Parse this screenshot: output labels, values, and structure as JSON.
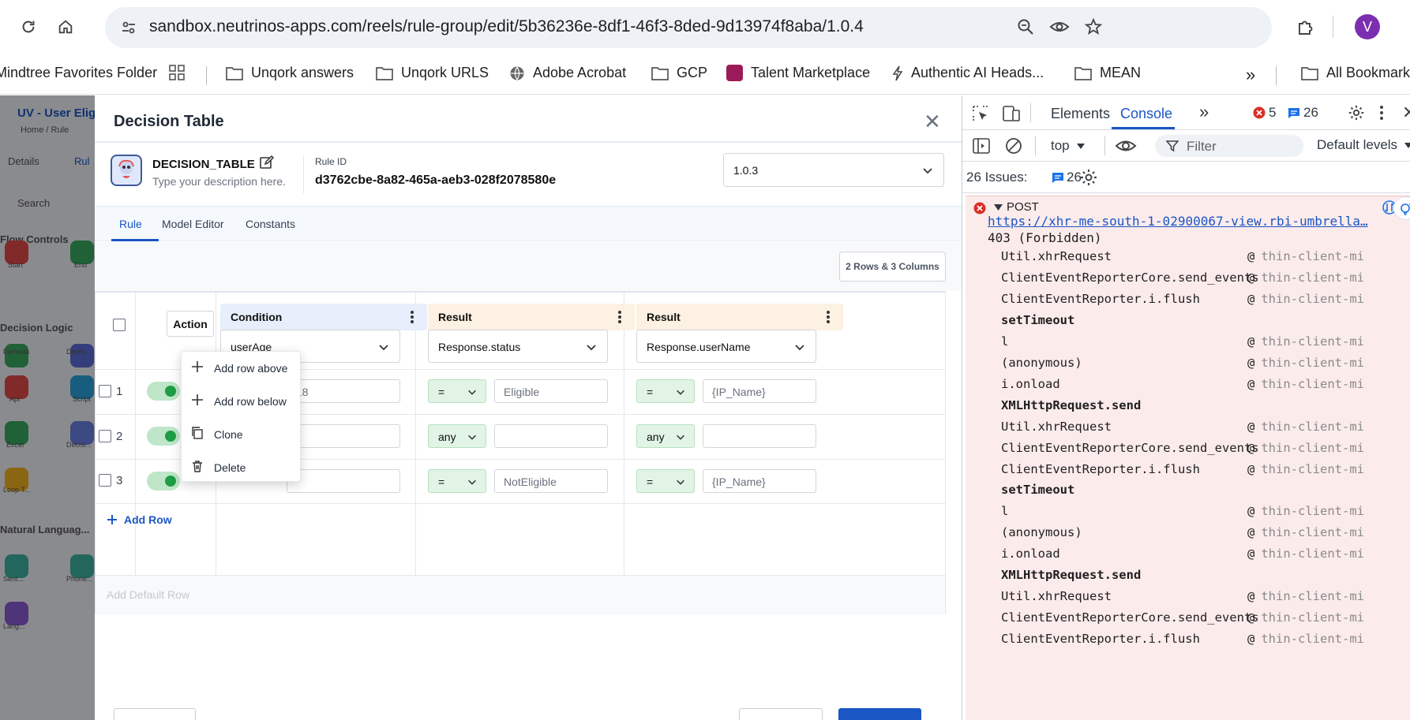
{
  "browser": {
    "url": "sandbox.neutrinos-apps.com/reels/rule-group/edit/5b36236e-8df1-46f3-8ded-9d13974f8aba/1.0.4",
    "profile_initial": "V",
    "bookmarks": [
      "Mindtree Favorites Folder",
      "Unqork answers",
      "Unqork URLS",
      "Adobe Acrobat",
      "GCP",
      "Talent Marketplace",
      "Authentic AI Heads...",
      "MEAN",
      "All Bookmarks"
    ]
  },
  "background_app": {
    "title": "UV - User Eligi",
    "breadcrumb": "Home  /  Rule",
    "tabs": [
      "Details",
      "Rul"
    ],
    "search_placeholder": "Search",
    "sections": [
      "Flow Controls",
      "Decision Logic",
      "Natural Languag..."
    ],
    "nodes": [
      "Start",
      "End",
      "Formula",
      "Decisi...",
      "Api",
      "Script",
      "Excel",
      "Decisi...",
      "Loop T...",
      "Sent...",
      "Phone...",
      "Lang..."
    ]
  },
  "dialog": {
    "title": "Decision Table",
    "rule_name": "DECISION_TABLE",
    "rule_description": "Type your description here.",
    "rule_id_label": "Rule ID",
    "rule_id": "d3762cbe-8a82-465a-aeb3-028f2078580e",
    "version": "1.0.3",
    "tabs": [
      "Rule",
      "Model Editor",
      "Constants"
    ],
    "rows_cols_badge": "2 Rows & 3 Columns",
    "columns": {
      "action": "Action",
      "condition": {
        "label": "Condition",
        "field": "userAge"
      },
      "result1": {
        "label": "Result",
        "field": "Response.status"
      },
      "result2": {
        "label": "Result",
        "field": "Response.userName"
      }
    },
    "rows": [
      {
        "num": "1",
        "cond_op": ">=",
        "cond_val": "18",
        "r1_op": "=",
        "r1_val": "Eligible",
        "r2_op": "=",
        "r2_val": "{IP_Name}"
      },
      {
        "num": "2",
        "cond_op": "",
        "cond_val": "",
        "r1_op": "any",
        "r1_val": "",
        "r2_op": "any",
        "r2_val": ""
      },
      {
        "num": "3",
        "cond_op": "",
        "cond_val": "",
        "r1_op": "=",
        "r1_val": "NotEligible",
        "r2_op": "=",
        "r2_val": "{IP_Name}"
      }
    ],
    "add_row": "Add Row",
    "add_default_row": "Add Default Row",
    "context_menu": [
      "Add row above",
      "Add row below",
      "Clone",
      "Delete"
    ]
  },
  "devtools": {
    "tabs": [
      "Elements",
      "Console"
    ],
    "error_count": "5",
    "message_count": "26",
    "context": "top",
    "filter_placeholder": "Filter",
    "levels": "Default levels",
    "issues_label": "26 Issues:",
    "issues_count": "26",
    "error": {
      "method": "POST",
      "url": "https://xhr-me-south-1-02900067-view.rbi-umbrella…",
      "status": "403 (Forbidden)"
    },
    "stack": [
      {
        "fn": "Util.xhrRequest",
        "at": "thin-client-mi",
        "bold": false
      },
      {
        "fn": "ClientEventReporterCore.send_events",
        "at": "thin-client-mi",
        "bold": false
      },
      {
        "fn": "ClientEventReporter.i.flush",
        "at": "thin-client-mi",
        "bold": false
      },
      {
        "fn": "setTimeout",
        "at": "",
        "bold": true
      },
      {
        "fn": "l",
        "at": "thin-client-mi",
        "bold": false
      },
      {
        "fn": "(anonymous)",
        "at": "thin-client-mi",
        "bold": false
      },
      {
        "fn": "i.onload",
        "at": "thin-client-mi",
        "bold": false
      },
      {
        "fn": "XMLHttpRequest.send",
        "at": "",
        "bold": true
      },
      {
        "fn": "Util.xhrRequest",
        "at": "thin-client-mi",
        "bold": false
      },
      {
        "fn": "ClientEventReporterCore.send_events",
        "at": "thin-client-mi",
        "bold": false
      },
      {
        "fn": "ClientEventReporter.i.flush",
        "at": "thin-client-mi",
        "bold": false
      },
      {
        "fn": "setTimeout",
        "at": "",
        "bold": true
      },
      {
        "fn": "l",
        "at": "thin-client-mi",
        "bold": false
      },
      {
        "fn": "(anonymous)",
        "at": "thin-client-mi",
        "bold": false
      },
      {
        "fn": "i.onload",
        "at": "thin-client-mi",
        "bold": false
      },
      {
        "fn": "XMLHttpRequest.send",
        "at": "",
        "bold": true
      },
      {
        "fn": "Util.xhrRequest",
        "at": "thin-client-mi",
        "bold": false
      },
      {
        "fn": "ClientEventReporterCore.send_events",
        "at": "thin-client-mi",
        "bold": false
      },
      {
        "fn": "ClientEventReporter.i.flush",
        "at": "thin-client-mi",
        "bold": false
      }
    ]
  }
}
